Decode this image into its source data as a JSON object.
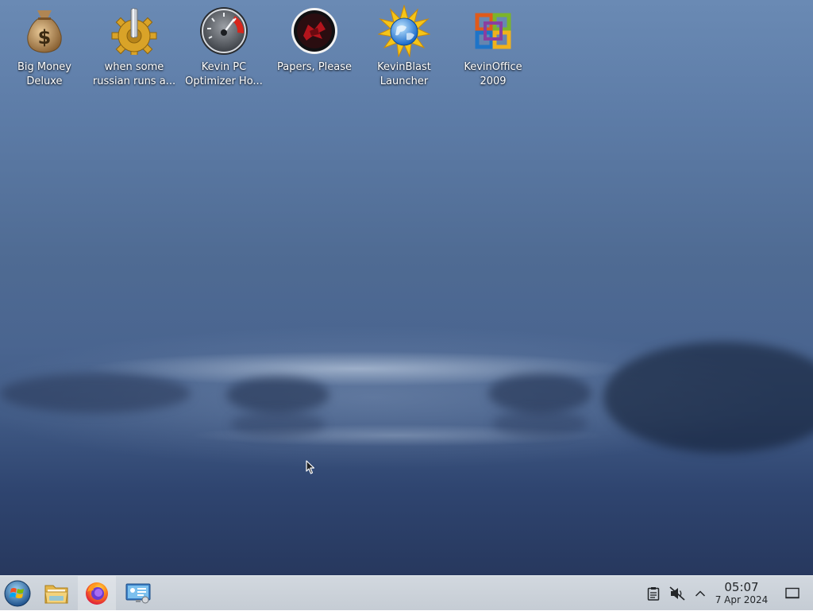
{
  "desktop": {
    "icons": [
      {
        "icon": "money-bag-icon",
        "label": "Big Money\nDeluxe"
      },
      {
        "icon": "gear-icon",
        "label": "when some\nrussian runs a..."
      },
      {
        "icon": "speedometer-icon",
        "label": "Kevin PC\nOptimizer Ho..."
      },
      {
        "icon": "papers-please-icon",
        "label": "Papers, Please"
      },
      {
        "icon": "globe-burst-icon",
        "label": "KevinBlast\nLauncher"
      },
      {
        "icon": "office-logo-icon",
        "label": "KevinOffice\n2009"
      }
    ]
  },
  "taskbar": {
    "start_icon": "start-orb-icon",
    "pinned": [
      {
        "icon": "file-manager-icon"
      },
      {
        "icon": "firefox-icon"
      },
      {
        "icon": "system-settings-icon"
      }
    ],
    "tray": {
      "clipboard_icon": "clipboard-icon",
      "volume_icon": "volume-muted-icon",
      "expand_icon": "chevron-up-icon",
      "clock_time": "05:07",
      "clock_date": "7 Apr 2024",
      "show_desktop_icon": "show-desktop-icon"
    }
  },
  "colors": {
    "sky_top": "#6a8ab4",
    "water_bottom": "#27385e",
    "taskbar_bg": "#cbd2d9",
    "accent": "#3daee9"
  }
}
